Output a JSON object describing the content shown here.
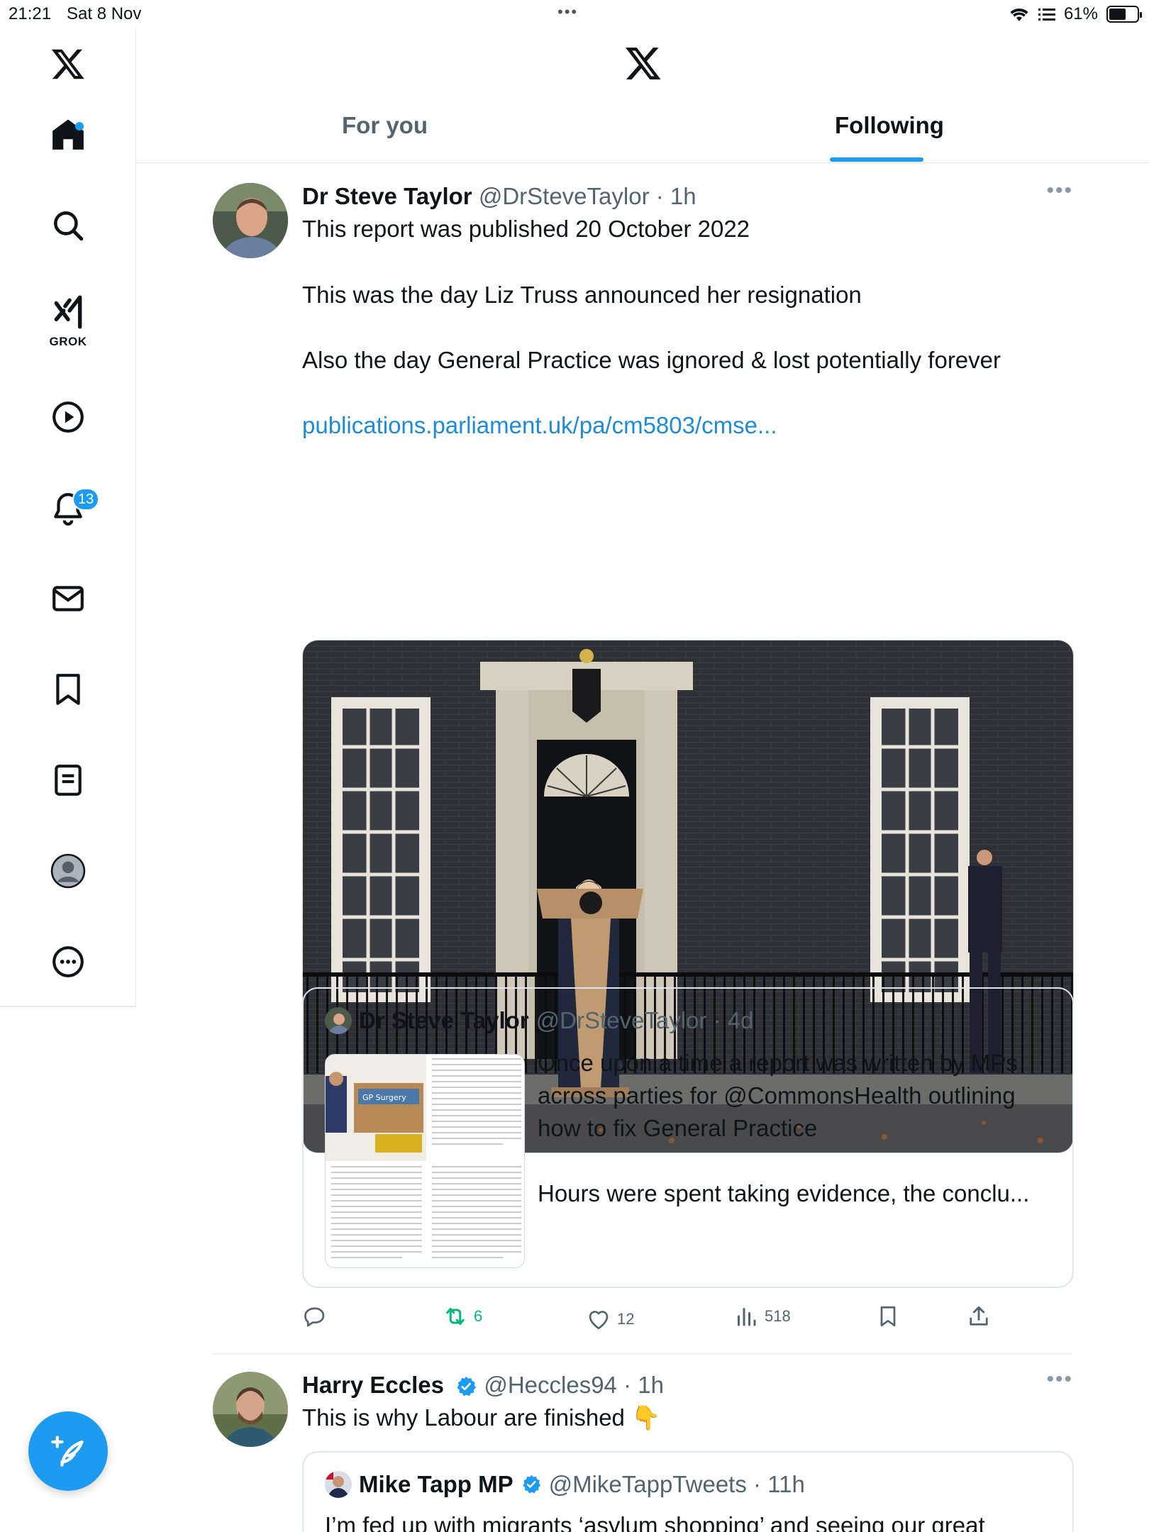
{
  "status_bar": {
    "time": "21:21",
    "date": "Sat 8 Nov",
    "battery": "61%",
    "battery_level": 0.61
  },
  "sidebar": {
    "items": [
      {
        "name": "x-logo-icon"
      },
      {
        "name": "home-icon",
        "has_dot": true
      },
      {
        "name": "search-icon"
      },
      {
        "name": "grok-icon",
        "label": "GROK"
      },
      {
        "name": "video-icon"
      },
      {
        "name": "notifications-icon",
        "badge": "13"
      },
      {
        "name": "messages-icon"
      },
      {
        "name": "bookmarks-icon"
      },
      {
        "name": "lists-icon"
      },
      {
        "name": "profile-avatar-icon"
      },
      {
        "name": "more-icon"
      }
    ],
    "compose_icon": "compose-feather-icon"
  },
  "header": {
    "tabs": [
      {
        "label": "For you",
        "active": false
      },
      {
        "label": "Following",
        "active": true
      }
    ]
  },
  "colors": {
    "accent": "#1d9bf0",
    "text": "#0f1419",
    "muted": "#536471",
    "retweet_green": "#00ba7c"
  },
  "tweets": [
    {
      "author": "Dr Steve Taylor",
      "handle": "@DrSteveTaylor",
      "time": "1h",
      "lines": [
        "This report was published  20 October 2022",
        "This was the day Liz Truss announced her resignation",
        "Also the day General Practice was ignored & lost potentially forever"
      ],
      "link": "publications.parliament.uk/pa/cm5803/cmse...",
      "quote": {
        "author": "Dr Steve Taylor",
        "handle": "@DrSteveTaylor",
        "time": "4d",
        "lines": [
          "Once upon a time a report was written by MPs",
          "across parties for @CommonsHealth outlining",
          "how to fix General Practice",
          "Hours were spent taking evidence, the conclu..."
        ],
        "thumb_sign": "GP Surgery"
      },
      "stats": {
        "replies": "",
        "retweets": "6",
        "likes": "12",
        "views": "518"
      }
    },
    {
      "author": "Harry Eccles",
      "handle": "@Heccles94",
      "time": "1h",
      "verified": true,
      "lines": [
        "This is why Labour are finished 👇"
      ],
      "quote": {
        "author": "Mike Tapp MP",
        "handle": "@MikeTappTweets",
        "time": "11h",
        "verified": true,
        "lines": [
          "I’m fed up with migrants ‘asylum shopping’ and seeing our great"
        ]
      }
    }
  ]
}
